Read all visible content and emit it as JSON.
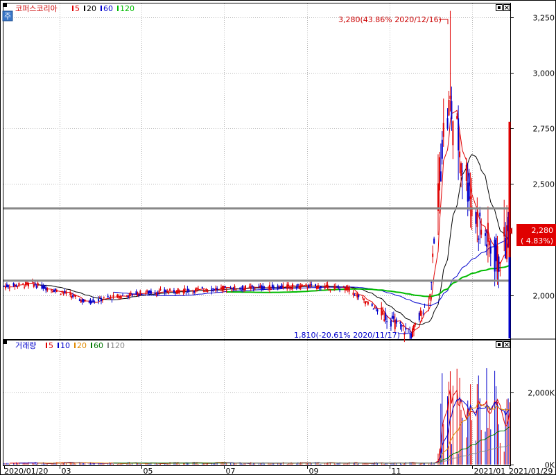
{
  "header": {
    "badge_char": "주",
    "legend_name": "코퍼스코리아",
    "ma_labels": [
      {
        "label": "5",
        "color": "#e00000"
      },
      {
        "label": "20",
        "color": "#000000"
      },
      {
        "label": "60",
        "color": "#0000cc"
      },
      {
        "label": "120",
        "color": "#00bb00"
      }
    ]
  },
  "volume_header": {
    "legend_name": "거래량",
    "ma_labels": [
      {
        "label": "5",
        "color": "#e00000"
      },
      {
        "label": "10",
        "color": "#0000cc"
      },
      {
        "label": "20",
        "color": "#e08a00"
      },
      {
        "label": "60",
        "color": "#007700"
      },
      {
        "label": "120",
        "color": "#888888"
      }
    ]
  },
  "icons": [
    "minimize-icon",
    "close-icon"
  ],
  "colors": {
    "up": "#e00000",
    "down": "#0000cc",
    "ma5": "#e00000",
    "ma20": "#000000",
    "ma60": "#0000cc",
    "ma120": "#00bb00",
    "support": "#888888"
  },
  "chart_data": {
    "type": "candlestick",
    "price_axis": {
      "ticks": [
        "3,250",
        "3,000",
        "2,750",
        "2,500",
        "2,000"
      ],
      "tick_values": [
        3250,
        3000,
        2750,
        2500,
        2000
      ],
      "ylim": [
        1805,
        3310
      ]
    },
    "volume_axis": {
      "ticks": [
        "2,000K",
        "0K"
      ],
      "tick_values": [
        2000000,
        0
      ],
      "ylim": [
        0,
        3200000
      ]
    },
    "x_labels": [
      "2020/01/20",
      "03",
      "05",
      "07",
      "09",
      "11",
      "2021/01",
      "2021/01/29"
    ],
    "x_label_dates": [
      "2020-01-20",
      "2020-03-01",
      "2020-05-01",
      "2020-07-01",
      "2020-09-01",
      "2020-11-01",
      "2021-01-01",
      "2021-01-29"
    ],
    "annotations": {
      "high": {
        "text": "3,280(43.86% 2020/12/16)",
        "date": "2020-12-16",
        "value": 3280
      },
      "low": {
        "text": "1,810(-20.61% 2020/11/17)",
        "date": "2020-11-17",
        "value": 1810
      }
    },
    "current": {
      "price_label": "2,280",
      "change_label": "( 4.83%)",
      "value": 2280
    },
    "support_lines": [
      2390,
      2065
    ],
    "key_points": [
      {
        "date": "2020-01-20",
        "close": 2040
      },
      {
        "date": "2020-02-10",
        "close": 2050
      },
      {
        "date": "2020-03-05",
        "close": 2010
      },
      {
        "date": "2020-03-20",
        "close": 1970
      },
      {
        "date": "2020-05-01",
        "close": 2010
      },
      {
        "date": "2020-07-01",
        "close": 2030
      },
      {
        "date": "2020-09-01",
        "close": 2040
      },
      {
        "date": "2020-10-01",
        "close": 2030
      },
      {
        "date": "2020-11-17",
        "close": 1820
      },
      {
        "date": "2020-12-01",
        "close": 2000
      },
      {
        "date": "2020-12-10",
        "close": 2700
      },
      {
        "date": "2020-12-16",
        "close": 2850
      },
      {
        "date": "2021-01-04",
        "close": 2350
      },
      {
        "date": "2021-01-20",
        "close": 2150
      },
      {
        "date": "2021-01-29",
        "close": 2280
      }
    ]
  }
}
